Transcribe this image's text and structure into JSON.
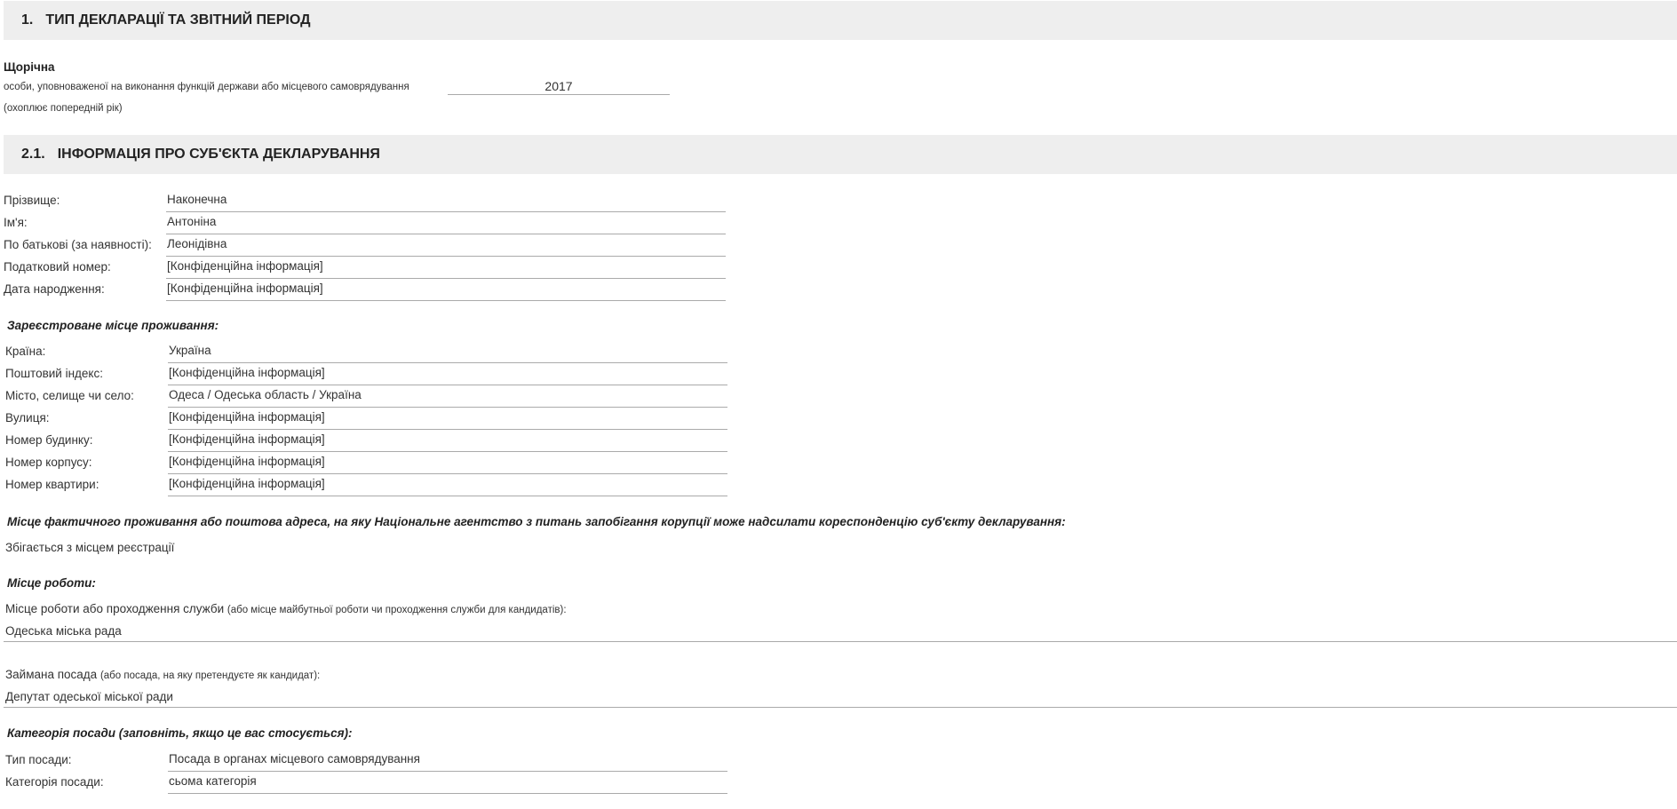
{
  "section1": {
    "num": "1.",
    "title": "ТИП ДЕКЛАРАЦІЇ ТА ЗВІТНИЙ ПЕРІОД"
  },
  "declaration": {
    "type": "Щорічна",
    "subject_line": "особи, уповноваженої на виконання функцій держави або місцевого самоврядування",
    "year": "2017",
    "note": "(охоплює попередній рік)"
  },
  "section21": {
    "num": "2.1.",
    "title": "ІНФОРМАЦІЯ ПРО СУБ'ЄКТА ДЕКЛАРУВАННЯ"
  },
  "person": [
    {
      "label": "Прізвище:",
      "value": "Наконечна"
    },
    {
      "label": "Ім'я:",
      "value": "Антоніна"
    },
    {
      "label": "По батькові (за наявності):",
      "value": "Леонідівна"
    },
    {
      "label": "Податковий номер:",
      "value": "[Конфіденційна інформація]"
    },
    {
      "label": "Дата народження:",
      "value": "[Конфіденційна інформація]"
    }
  ],
  "registered_address": {
    "heading": "Зареєстроване місце проживання:",
    "rows": [
      {
        "label": "Країна:",
        "value": "Україна"
      },
      {
        "label": "Поштовий індекс:",
        "value": "[Конфіденційна інформація]"
      },
      {
        "label": "Місто, селище чи село:",
        "value": "Одеса / Одеська область / Україна"
      },
      {
        "label": "Вулиця:",
        "value": "[Конфіденційна інформація]"
      },
      {
        "label": "Номер будинку:",
        "value": "[Конфіденційна інформація]"
      },
      {
        "label": "Номер корпусу:",
        "value": "[Конфіденційна інформація]"
      },
      {
        "label": "Номер квартири:",
        "value": "[Конфіденційна інформація]"
      }
    ]
  },
  "actual_address": {
    "heading": "Місце фактичного проживання або поштова адреса, на яку Національне агентство з питань запобігання корупції може надсилати кореспонденцію суб'єкту декларування:",
    "value": "Збігається з місцем реєстрації"
  },
  "work": {
    "heading": "Місце роботи:",
    "workplace_label": "Місце роботи або проходження служби",
    "workplace_note": "(або місце майбутньої роботи чи проходження служби для кандидатів):",
    "workplace_value": "Одеська міська рада",
    "position_label": "Займана посада",
    "position_note": "(або посада, на яку претендуєте як кандидат):",
    "position_value": "Депутат одеської міської ради"
  },
  "category": {
    "heading": "Категорія посади (заповніть, якщо це вас стосується):",
    "rows": [
      {
        "label": "Тип посади:",
        "value": "Посада в органах місцевого самоврядування"
      },
      {
        "label": "Категорія посади:",
        "value": "сьома категорія"
      }
    ]
  }
}
